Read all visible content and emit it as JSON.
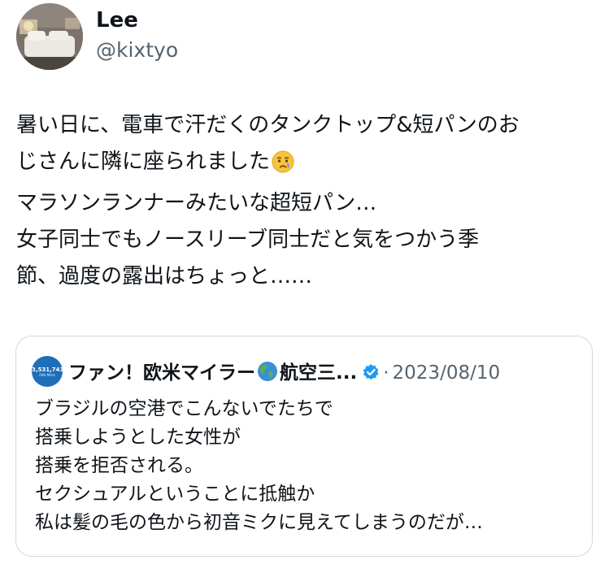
{
  "author": {
    "display_name": "Lee",
    "handle": "@kixtyo"
  },
  "tweet": {
    "lines": [
      "暑い日に、電車で汗だくのタンクトップ&短パンのお",
      "じさんに隣に座られました",
      "マラソンランナーみたいな超短パン…",
      "女子同士でもノースリーブ同士だと気をつかう季",
      "節、過度の露出はちょっと……"
    ],
    "emoji": "crying-face"
  },
  "quote": {
    "avatar_text": "3,531,741",
    "avatar_subtext": "ANA Miles",
    "author_name": "ファン！欧米マイラー",
    "author_name_suffix": "航空三...",
    "name_emoji": "globe-americas",
    "verified": true,
    "separator": "·",
    "date": "2023/08/10",
    "lines": [
      "ブラジルの空港でこんないでたちで",
      "搭乗しようとした女性が",
      "搭乗を拒否される。",
      "セクシュアルということに抵触か",
      "私は髪の毛の色から初音ミクに見えてしまうのだが…"
    ]
  },
  "colors": {
    "text_primary": "#0f1419",
    "text_secondary": "#536471",
    "border": "#cfd9de",
    "verified_blue": "#1d9bf0"
  }
}
